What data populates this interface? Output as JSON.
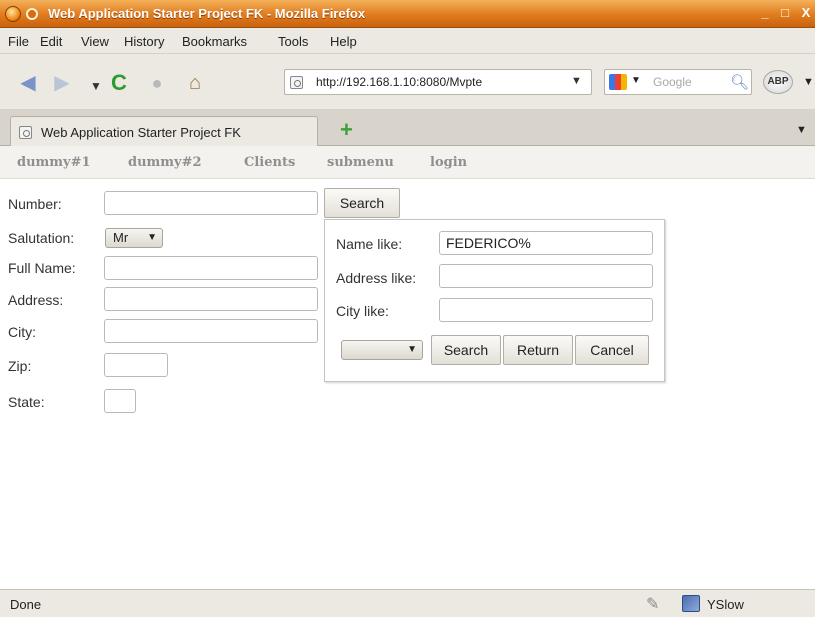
{
  "window": {
    "title": "Web Application Starter Project FK - Mozilla Firefox",
    "min_glyph": "_",
    "max_glyph": "□",
    "close_glyph": "X"
  },
  "menu": [
    {
      "label": "File"
    },
    {
      "label": "Edit"
    },
    {
      "label": "View"
    },
    {
      "label": "History"
    },
    {
      "label": "Bookmarks"
    },
    {
      "label": "Tools"
    },
    {
      "label": "Help"
    }
  ],
  "nav": {
    "url": "http://192.168.1.10:8080/Mvpte",
    "search_placeholder": "Google",
    "abp_label": "ABP"
  },
  "tab": {
    "label": "Web Application Starter Project FK",
    "new_tab_glyph": "+"
  },
  "app_menu": [
    {
      "label": "dummy#1"
    },
    {
      "label": "dummy#2"
    },
    {
      "label": "Clients"
    },
    {
      "label": "submenu"
    },
    {
      "label": "login"
    }
  ],
  "form": {
    "number_label": "Number:",
    "number_value": "",
    "salutation_label": "Salutation:",
    "salutation_value": "Mr",
    "fullname_label": "Full Name:",
    "fullname_value": "",
    "address_label": "Address:",
    "address_value": "",
    "city_label": "City:",
    "city_value": "",
    "zip_label": "Zip:",
    "zip_value": "",
    "state_label": "State:",
    "state_value": "",
    "search_button": "Search"
  },
  "search_panel": {
    "name_label": "Name like:",
    "name_value": "FEDERICO%",
    "address_label": "Address like:",
    "address_value": "",
    "city_label": "City like:",
    "city_value": "",
    "select_value": "",
    "search_button": "Search",
    "return_button": "Return",
    "cancel_button": "Cancel"
  },
  "status": {
    "text": "Done",
    "yslow": "YSlow"
  }
}
